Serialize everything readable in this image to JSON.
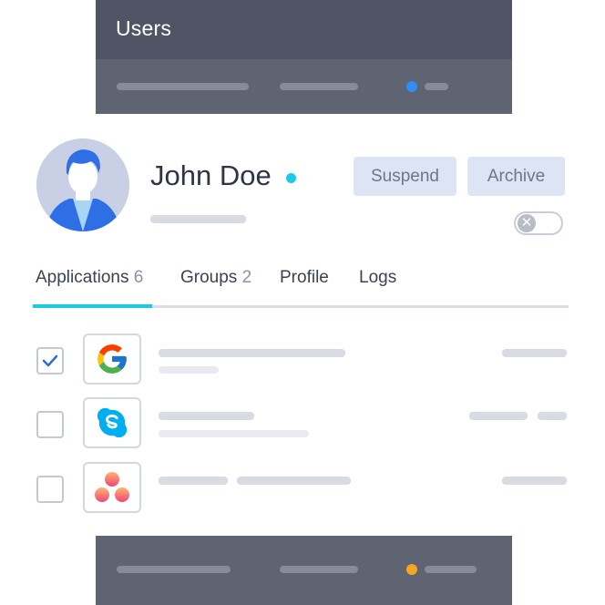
{
  "window": {
    "title": "Users"
  },
  "user": {
    "name": "John Doe"
  },
  "actions": {
    "suspend_label": "Suspend",
    "archive_label": "Archive"
  },
  "tabs": [
    {
      "label": "Applications",
      "count": "6",
      "active": true
    },
    {
      "label": "Groups",
      "count": "2",
      "active": false
    },
    {
      "label": "Profile",
      "count": "",
      "active": false
    },
    {
      "label": "Logs",
      "count": "",
      "active": false
    }
  ],
  "applications": [
    {
      "icon": "google-icon",
      "checked": true
    },
    {
      "icon": "skype-icon",
      "checked": false
    },
    {
      "icon": "asana-icon",
      "checked": false
    }
  ],
  "colors": {
    "accent": "#1ec9e8",
    "status_online": "#1ec9e8",
    "top_indicator": "#2d8ef5",
    "bottom_indicator": "#f5a623",
    "window_bg": "#5e6472",
    "button_bg": "#dde5f4"
  }
}
